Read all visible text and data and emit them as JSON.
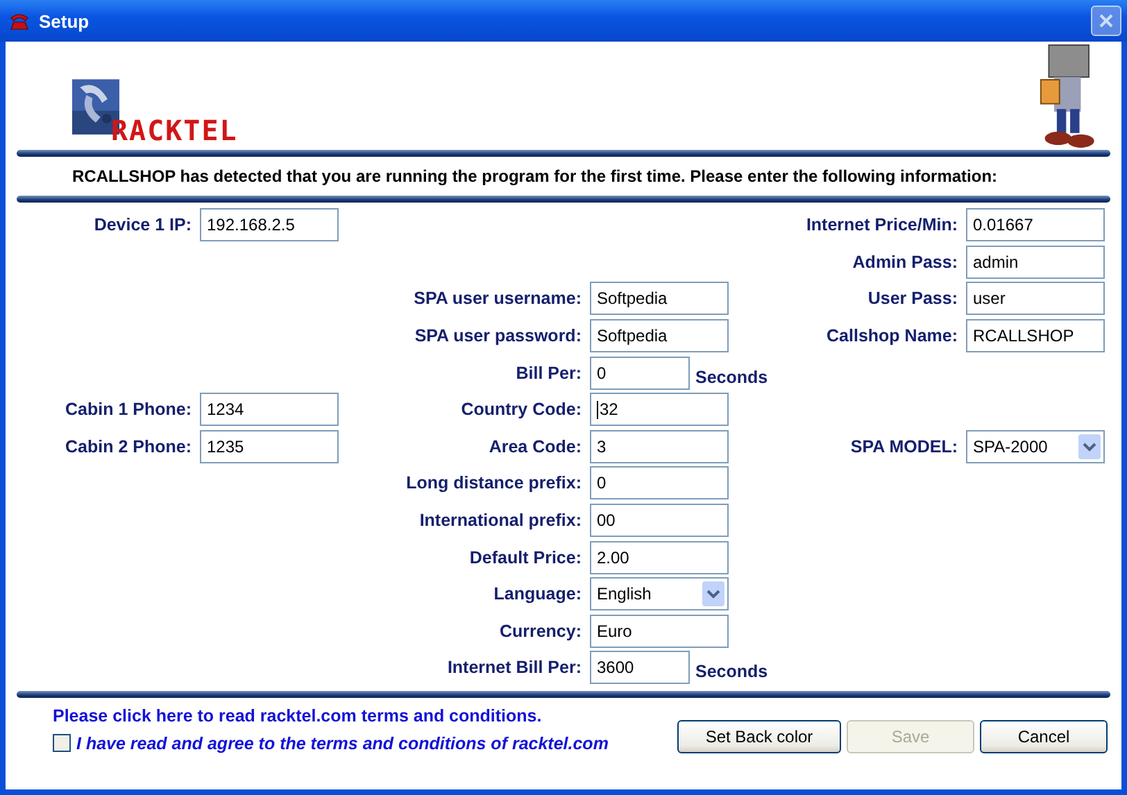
{
  "window": {
    "title": "Setup",
    "close_disabled": true
  },
  "logo": {
    "text": "RACKTEL"
  },
  "notice": "RCALLSHOP has detected that you are running the program for the first time. Please enter the following information:",
  "left_fields": [
    {
      "label": "Device 1 IP:",
      "kind": "text",
      "value": "192.168.2.5"
    },
    {
      "label": "Cabin 1 Phone:",
      "kind": "text",
      "value": "1234"
    },
    {
      "label": "Cabin 2 Phone:",
      "kind": "text",
      "value": "1235"
    }
  ],
  "middle_fields": [
    {
      "label": "SPA user username:",
      "kind": "text",
      "value": "Softpedia"
    },
    {
      "label": "SPA user password:",
      "kind": "text",
      "value": "Softpedia"
    },
    {
      "label": "Bill Per:",
      "kind": "text",
      "value": "0",
      "suffix": "Seconds"
    },
    {
      "label": "Country Code:",
      "kind": "text",
      "value": "32",
      "focused": true
    },
    {
      "label": "Area Code:",
      "kind": "text",
      "value": "3"
    },
    {
      "label": "Long distance prefix:",
      "kind": "text",
      "value": "0"
    },
    {
      "label": "International prefix:",
      "kind": "text",
      "value": "00"
    },
    {
      "label": "Default Price:",
      "kind": "text",
      "value": "2.00"
    },
    {
      "label": "Language:",
      "kind": "dropdown",
      "value": "English"
    },
    {
      "label": "Currency:",
      "kind": "text",
      "value": "Euro"
    },
    {
      "label": "Internet Bill Per:",
      "kind": "text",
      "value": "3600",
      "suffix": "Seconds"
    }
  ],
  "right_fields": [
    {
      "label": "Internet Price/Min:",
      "kind": "text",
      "value": "0.01667"
    },
    {
      "label": "Admin Pass:",
      "kind": "text",
      "value": "admin"
    },
    {
      "label": "User Pass:",
      "kind": "text",
      "value": "user"
    },
    {
      "label": "Callshop Name:",
      "kind": "text",
      "value": "RCALLSHOP"
    },
    {
      "label": "SPA MODEL:",
      "kind": "dropdown",
      "value": "SPA-2000"
    }
  ],
  "terms_link": "Please click here to read racktel.com terms and conditions.",
  "agree": {
    "label": "I have read and agree to the terms and conditions of racktel.com",
    "checked": false
  },
  "buttons": [
    {
      "label": "Set Back color",
      "disabled": false
    },
    {
      "label": "Save",
      "disabled": true
    },
    {
      "label": "Cancel",
      "disabled": false
    }
  ]
}
